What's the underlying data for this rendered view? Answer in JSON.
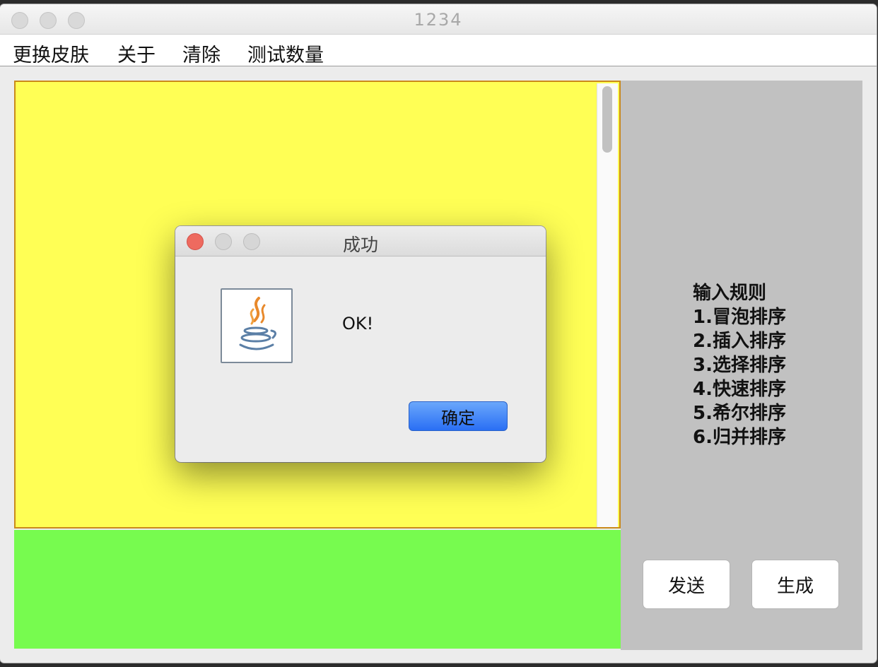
{
  "window": {
    "title": "1234"
  },
  "menu": {
    "items": [
      "更换皮肤",
      "关于",
      "清除",
      "测试数量"
    ]
  },
  "rules": {
    "heading": "输入规则",
    "items": [
      "1.冒泡排序",
      "2.插入排序",
      "3.选择排序",
      "4.快速排序",
      "5.希尔排序",
      "6.归并排序"
    ]
  },
  "buttons": {
    "send": "发送",
    "generate": "生成"
  },
  "dialog": {
    "title": "成功",
    "message": "OK!",
    "confirm": "确定",
    "icon": "java-icon"
  },
  "colors": {
    "output_background": "#ffff55",
    "input_background": "#77fb4f",
    "side_panel": "#c1c1c1",
    "confirm_button": "#2a6ff4",
    "close_dot": "#ee6a5f"
  }
}
